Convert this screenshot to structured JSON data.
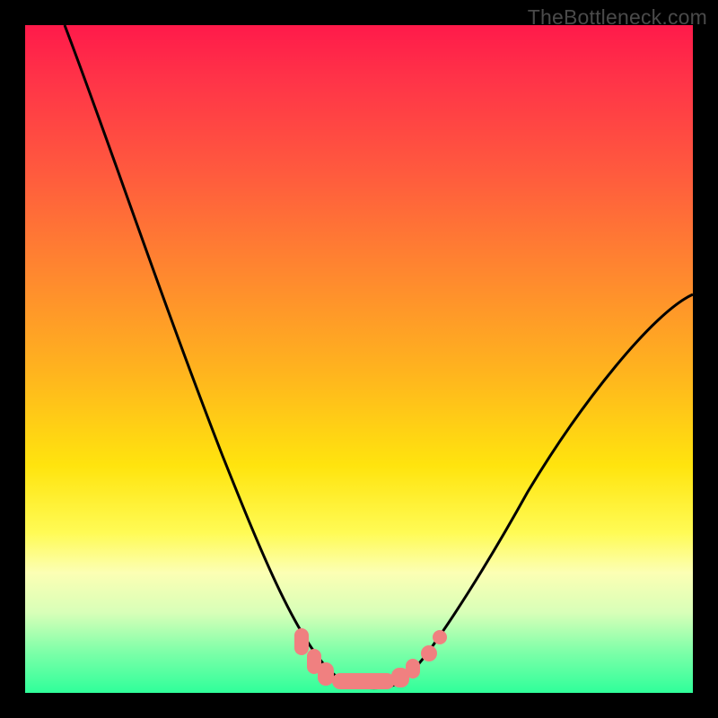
{
  "watermark": "TheBottleneck.com",
  "chart_data": {
    "type": "line",
    "title": "",
    "xlabel": "",
    "ylabel": "",
    "xlim": [
      0,
      100
    ],
    "ylim": [
      0,
      100
    ],
    "grid": false,
    "legend": null,
    "series": [
      {
        "name": "bottleneck-curve",
        "color": "#000000",
        "x": [
          6,
          10,
          15,
          20,
          25,
          30,
          35,
          38,
          41,
          44,
          46,
          48,
          50,
          53,
          56,
          58,
          60,
          62,
          65,
          70,
          75,
          80,
          85,
          90,
          95,
          100
        ],
        "y": [
          100,
          88,
          75,
          62,
          50,
          38,
          26,
          18,
          12,
          7,
          4,
          2.5,
          2,
          2,
          2.5,
          3.5,
          5,
          7,
          11,
          19,
          27,
          35,
          42,
          48,
          54,
          59
        ]
      },
      {
        "name": "bottom-highlight",
        "color": "#f08080",
        "x": [
          41,
          44,
          46,
          48,
          50,
          53,
          56,
          58,
          60,
          62
        ],
        "y": [
          12,
          7,
          4,
          2.5,
          2,
          2,
          2.5,
          3.5,
          5,
          7
        ]
      }
    ],
    "annotations": []
  }
}
